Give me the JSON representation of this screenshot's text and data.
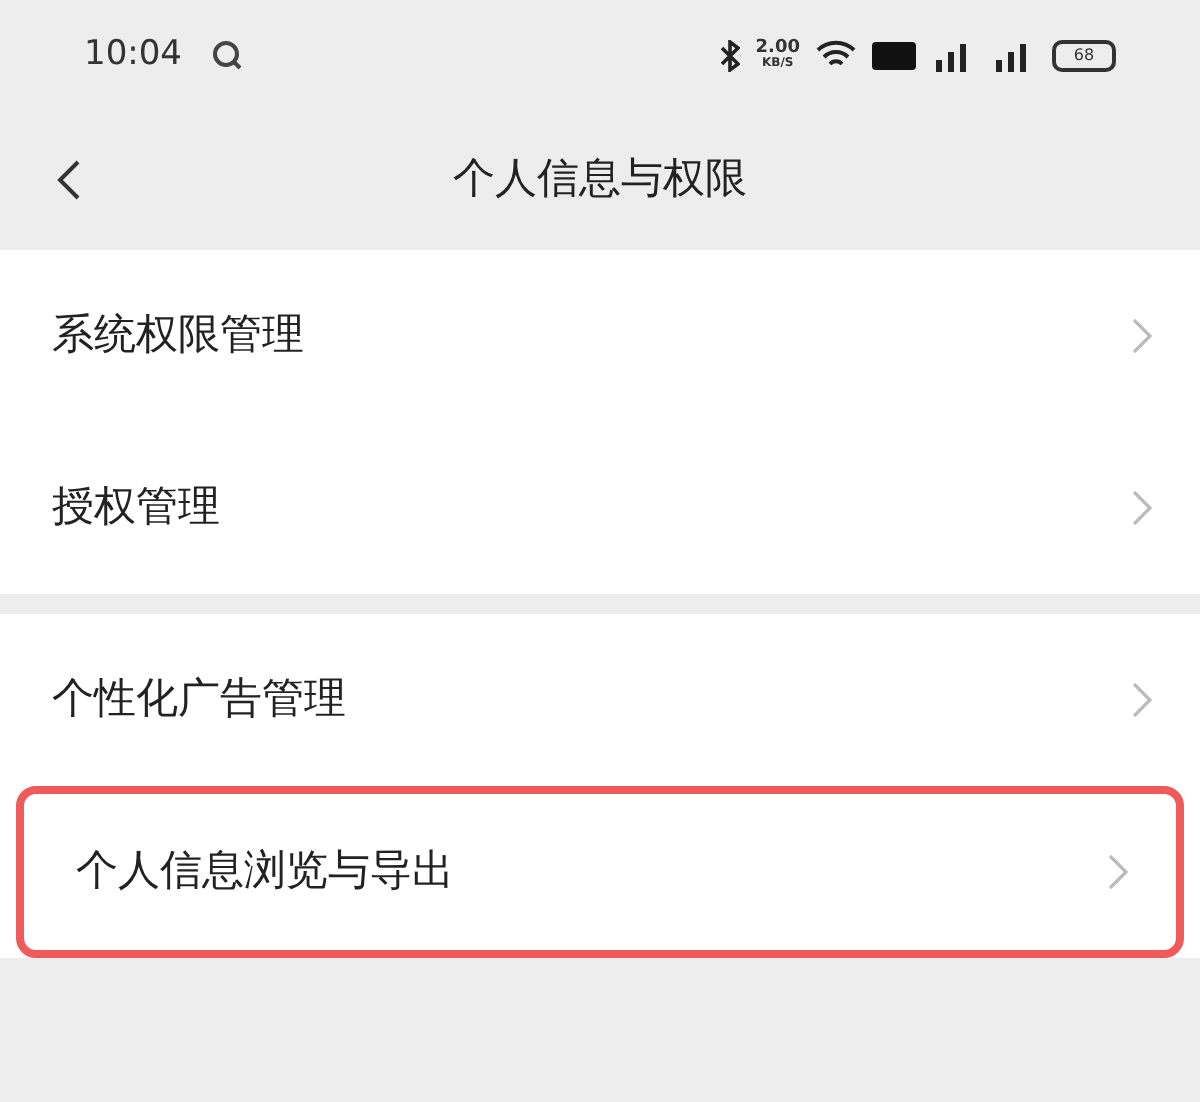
{
  "status_bar": {
    "time": "10:04",
    "speed": "2.00",
    "speed_unit": "KB/S",
    "battery": "68"
  },
  "header": {
    "title": "个人信息与权限"
  },
  "groups": [
    {
      "items": [
        {
          "label": "系统权限管理",
          "highlighted": false
        },
        {
          "label": "授权管理",
          "highlighted": false
        }
      ]
    },
    {
      "items": [
        {
          "label": "个性化广告管理",
          "highlighted": false
        },
        {
          "label": "个人信息浏览与导出",
          "highlighted": true
        }
      ]
    }
  ]
}
